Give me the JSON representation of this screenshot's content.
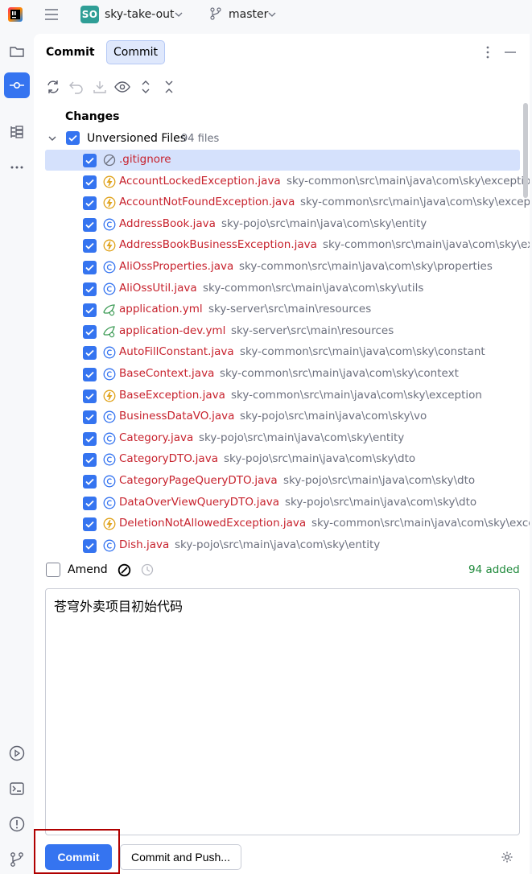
{
  "titlebar": {
    "project_badge": "SO",
    "project_name": "sky-take-out",
    "branch_name": "master"
  },
  "left_strip": {
    "top_icons": [
      "folder-icon",
      "commit-icon",
      "structure-icon",
      "more-icon"
    ],
    "bottom_icons": [
      "run-icon",
      "terminal-icon",
      "problems-icon",
      "git-icon"
    ]
  },
  "header": {
    "title": "Commit",
    "tab_label": "Commit"
  },
  "changes": {
    "title": "Changes",
    "group_label": "Unversioned Files",
    "group_count": "94 files",
    "files": [
      {
        "name": ".gitignore",
        "path": "",
        "icon": "ignore-icon"
      },
      {
        "name": "AccountLockedException.java",
        "path": "sky-common\\src\\main\\java\\com\\sky\\exception",
        "icon": "exception-icon"
      },
      {
        "name": "AccountNotFoundException.java",
        "path": "sky-common\\src\\main\\java\\com\\sky\\exception",
        "icon": "exception-icon"
      },
      {
        "name": "AddressBook.java",
        "path": "sky-pojo\\src\\main\\java\\com\\sky\\entity",
        "icon": "class-icon"
      },
      {
        "name": "AddressBookBusinessException.java",
        "path": "sky-common\\src\\main\\java\\com\\sky\\except",
        "icon": "exception-icon"
      },
      {
        "name": "AliOssProperties.java",
        "path": "sky-common\\src\\main\\java\\com\\sky\\properties",
        "icon": "class-icon"
      },
      {
        "name": "AliOssUtil.java",
        "path": "sky-common\\src\\main\\java\\com\\sky\\utils",
        "icon": "class-icon"
      },
      {
        "name": "application.yml",
        "path": "sky-server\\src\\main\\resources",
        "icon": "yaml-icon"
      },
      {
        "name": "application-dev.yml",
        "path": "sky-server\\src\\main\\resources",
        "icon": "yaml-icon"
      },
      {
        "name": "AutoFillConstant.java",
        "path": "sky-common\\src\\main\\java\\com\\sky\\constant",
        "icon": "class-icon"
      },
      {
        "name": "BaseContext.java",
        "path": "sky-common\\src\\main\\java\\com\\sky\\context",
        "icon": "class-icon"
      },
      {
        "name": "BaseException.java",
        "path": "sky-common\\src\\main\\java\\com\\sky\\exception",
        "icon": "exception-icon"
      },
      {
        "name": "BusinessDataVO.java",
        "path": "sky-pojo\\src\\main\\java\\com\\sky\\vo",
        "icon": "class-icon"
      },
      {
        "name": "Category.java",
        "path": "sky-pojo\\src\\main\\java\\com\\sky\\entity",
        "icon": "class-icon"
      },
      {
        "name": "CategoryDTO.java",
        "path": "sky-pojo\\src\\main\\java\\com\\sky\\dto",
        "icon": "class-icon"
      },
      {
        "name": "CategoryPageQueryDTO.java",
        "path": "sky-pojo\\src\\main\\java\\com\\sky\\dto",
        "icon": "class-icon"
      },
      {
        "name": "DataOverViewQueryDTO.java",
        "path": "sky-pojo\\src\\main\\java\\com\\sky\\dto",
        "icon": "class-icon"
      },
      {
        "name": "DeletionNotAllowedException.java",
        "path": "sky-common\\src\\main\\java\\com\\sky\\excepti",
        "icon": "exception-icon"
      },
      {
        "name": "Dish.java",
        "path": "sky-pojo\\src\\main\\java\\com\\sky\\entity",
        "icon": "class-icon"
      }
    ]
  },
  "amend": {
    "label": "Amend",
    "added_count": "94 added"
  },
  "message": {
    "text": "苍穹外卖项目初始代码"
  },
  "actions": {
    "commit_label": "Commit",
    "commit_push_label": "Commit and Push..."
  },
  "colors": {
    "accent": "#3574f0",
    "unversioned_file": "#c7222d",
    "path_gray": "#6c707e",
    "added_green": "#208a3c",
    "highlight_red": "#b00000"
  }
}
